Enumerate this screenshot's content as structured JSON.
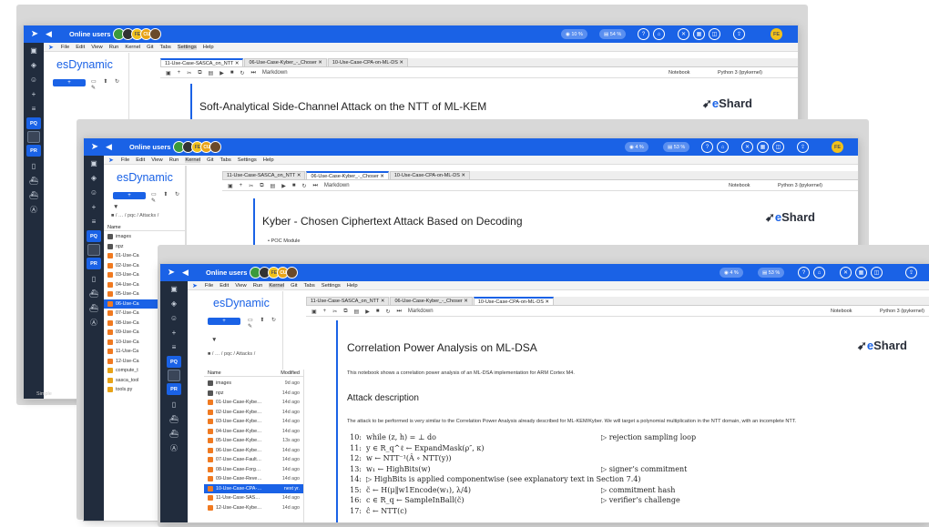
{
  "app": {
    "online_label": "Online users",
    "user_initials": "FE",
    "brand": "esDynamic",
    "simple_label": "Simple"
  },
  "avatars": [
    "",
    "",
    "FE",
    "CU",
    ""
  ],
  "windows": [
    {
      "cpu": "10 %",
      "mem": "54 %"
    },
    {
      "cpu": "4 %",
      "mem": "53 %"
    },
    {
      "cpu": "4 %",
      "mem": "53 %"
    }
  ],
  "menu": [
    "File",
    "Edit",
    "View",
    "Run",
    "Kernel",
    "Git",
    "Tabs",
    "Settings",
    "Help"
  ],
  "sidebar_badges": {
    "pq": "PQ",
    "pr": "PR"
  },
  "filebrowser": {
    "new_label": "+",
    "breadcrumb": "■ / … / pqc / Attacks /",
    "col_name": "Name",
    "col_modified": "Modified"
  },
  "files": [
    {
      "name": "images",
      "modified": "9d ago",
      "type": "folder"
    },
    {
      "name": "npz",
      "modified": "14d ago",
      "type": "folder"
    },
    {
      "name": "01-Use-Case-Kybe…",
      "modified": "14d ago",
      "type": "nb"
    },
    {
      "name": "02-Use-Case-Kybe…",
      "modified": "14d ago",
      "type": "nb"
    },
    {
      "name": "03-Use-Case-Kybe…",
      "modified": "14d ago",
      "type": "nb"
    },
    {
      "name": "04-Use-Case-Kybe…",
      "modified": "14d ago",
      "type": "nb"
    },
    {
      "name": "05-Use-Case-Kybe…",
      "modified": "13s ago",
      "type": "nb"
    },
    {
      "name": "06-Use-Case-Kybe…",
      "modified": "14d ago",
      "type": "nb"
    },
    {
      "name": "07-Use-Case-Fault…",
      "modified": "14d ago",
      "type": "nb"
    },
    {
      "name": "08-Use-Case-Forg…",
      "modified": "14d ago",
      "type": "nb"
    },
    {
      "name": "09-Use-Case-Reve…",
      "modified": "14d ago",
      "type": "nb"
    },
    {
      "name": "10-Use-Case-CPA-…",
      "modified": "next yr.",
      "type": "nb",
      "selected": true
    },
    {
      "name": "11-Use-Case-SAS…",
      "modified": "14d ago",
      "type": "nb"
    },
    {
      "name": "12-Use-Case-Kybe…",
      "modified": "14d ago",
      "type": "nb"
    }
  ],
  "files_mid": [
    "images",
    "npz",
    "01-Use-Ca",
    "02-Use-Ca",
    "03-Use-Ca",
    "04-Use-Ca",
    "05-Use-Ca",
    "06-Use-Ca",
    "07-Use-Ca",
    "08-Use-Ca",
    "09-Use-Ca",
    "10-Use-Ca",
    "11-Use-Ca",
    "12-Use-Ca",
    "compute_t",
    "sasca_tool",
    "tools.py"
  ],
  "tabs": [
    "11-Use-Case-SASCA_on_NTT",
    "06-Use-Case-Kyber_-_Choser",
    "10-Use-Case-CPA-on-ML-DS"
  ],
  "toolbar": {
    "celltype": "Markdown",
    "notebook": "Notebook",
    "kernel": "Python 3 (ipykernel)"
  },
  "nb1": {
    "title": "Soft-Analytical Side-Channel Attack on the NTT of ML-KEM"
  },
  "nb2": {
    "title": "Kyber - Chosen Ciphertext Attack Based on Decoding",
    "sub": "• POC Module"
  },
  "nb3": {
    "title": "Correlation Power Analysis on ML-DSA",
    "intro": "This notebook shows a correlation power analysis of an ML-DSA implementation for ARM Cortex M4.",
    "h2": "Attack description",
    "desc": "The attack to be performed is very similar to the Correlation Power Analysis already described for ML-KEM/Kyber. We will target a polynomial multiplication in the NTT domain, with an incomplete NTT.",
    "alg": [
      {
        "n": "10:",
        "s": "while (z, h) = ⊥ do",
        "c": "▷ rejection sampling loop"
      },
      {
        "n": "11:",
        "s": "y ∈ R_q^ℓ ← ExpandMask(ρ″, κ)",
        "c": ""
      },
      {
        "n": "12:",
        "s": "w ← NTT⁻¹(Â ∘ NTT(y))",
        "c": ""
      },
      {
        "n": "13:",
        "s": "w₁ ← HighBits(w)",
        "c": "▷ signer’s commitment"
      },
      {
        "n": "14:",
        "s": "▷ HighBits is applied componentwise (see explanatory text in Section 7.4)",
        "c": ""
      },
      {
        "n": "15:",
        "s": "c̃ ← H(μ‖w1Encode(w₁), λ/4)",
        "c": "▷ commitment hash"
      },
      {
        "n": "16:",
        "s": "c ∈ R_q ← SampleInBall(c̃)",
        "c": "▷ verifier’s challenge"
      },
      {
        "n": "17:",
        "s": "ĉ ← NTT(c)",
        "c": ""
      }
    ]
  },
  "logo": {
    "pre": "e",
    "post": "Shard"
  }
}
